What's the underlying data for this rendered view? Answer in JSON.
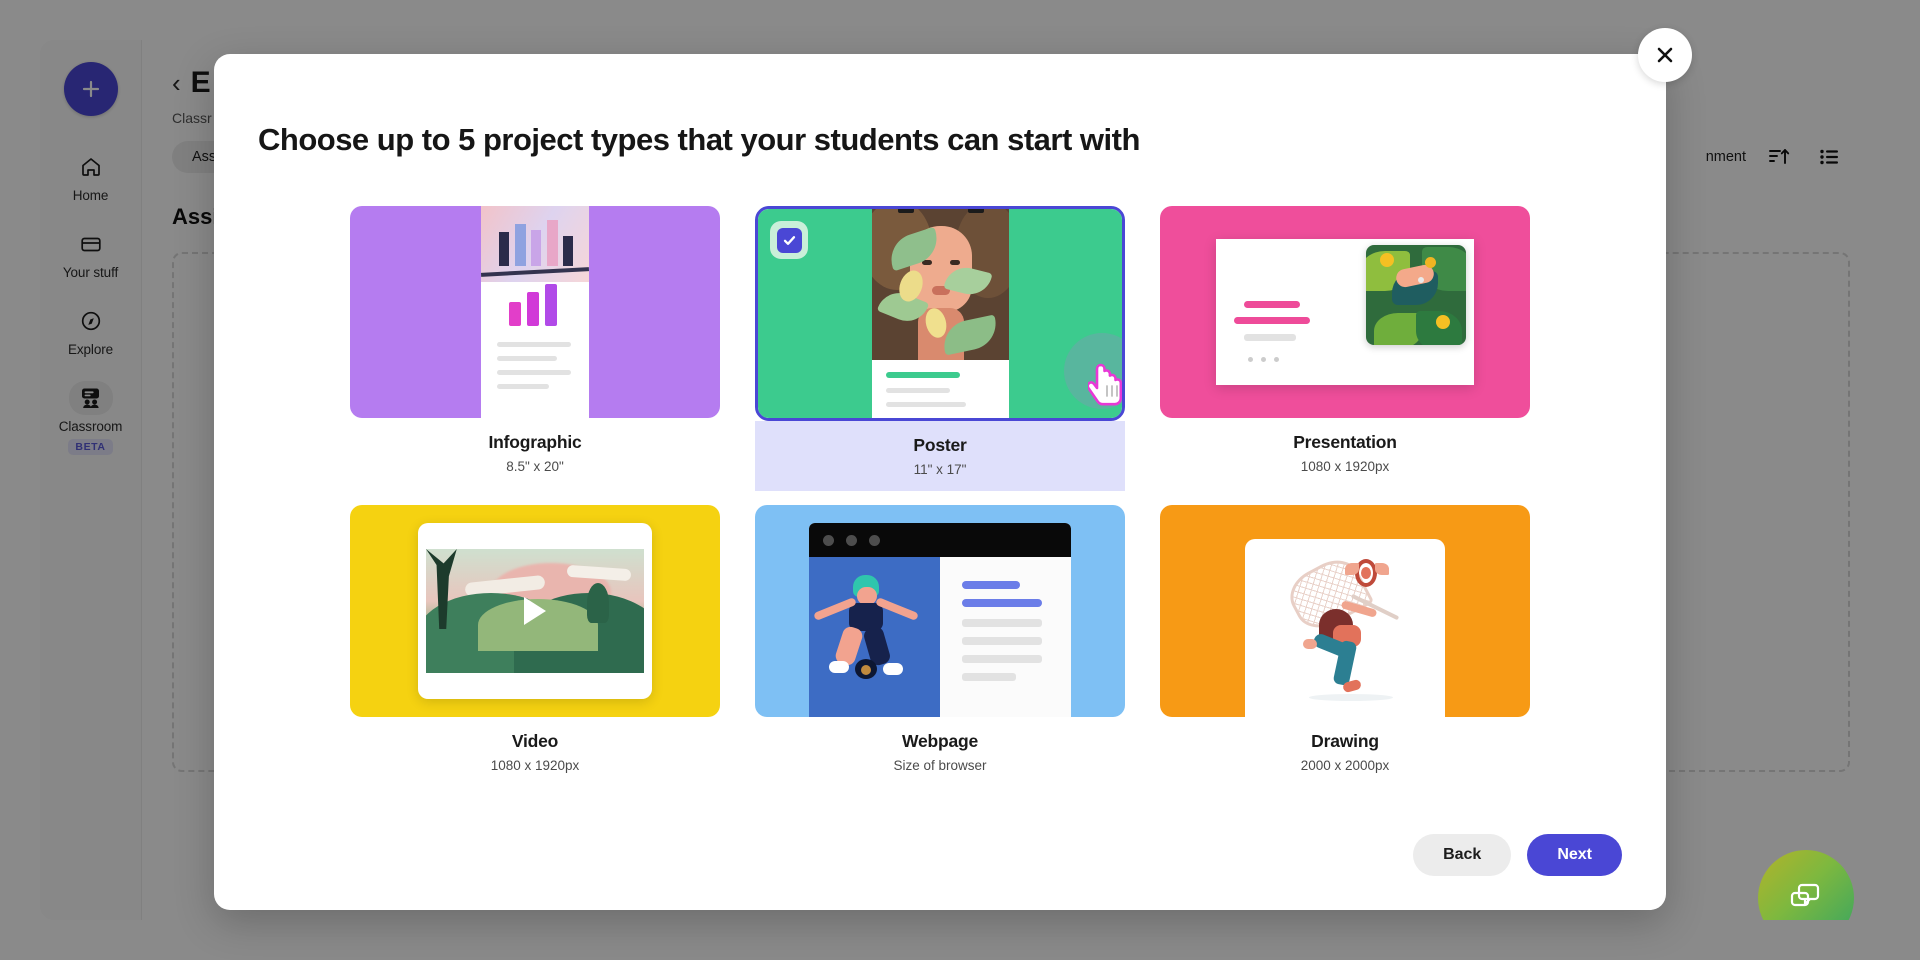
{
  "sidebar": {
    "create_button_label": "+",
    "items": [
      {
        "label": "Home",
        "icon": "home-icon",
        "active": false
      },
      {
        "label": "Your stuff",
        "icon": "folder-icon",
        "active": false
      },
      {
        "label": "Explore",
        "icon": "compass-icon",
        "active": false
      },
      {
        "label": "Classroom",
        "icon": "classroom-icon",
        "active": true,
        "badge": "BETA"
      }
    ]
  },
  "background": {
    "back_label": "‹",
    "page_title": "E",
    "breadcrumb": "Classr",
    "tab_label": "Assi",
    "section_title": "Assig",
    "new_assignment_label": "nment",
    "sort_icon": "sort-ascending-icon",
    "list_view_icon": "list-view-icon",
    "fab_icon": "chat-bubbles-icon"
  },
  "modal": {
    "close_label": "✕",
    "title": "Choose up to 5 project types that your students can start with",
    "max_selection": 5,
    "cards": [
      {
        "name": "Infographic",
        "size": "8.5\" x 20\"",
        "color": "#b57cf0",
        "selected": false,
        "art": "infographic"
      },
      {
        "name": "Poster",
        "size": "11\" x 17\"",
        "color": "#3ccb8e",
        "selected": true,
        "art": "poster"
      },
      {
        "name": "Presentation",
        "size": "1080 x 1920px",
        "color": "#ef4e9b",
        "selected": false,
        "art": "presentation"
      },
      {
        "name": "Video",
        "size": "1080 x 1920px",
        "color": "#f5d211",
        "selected": false,
        "art": "video"
      },
      {
        "name": "Webpage",
        "size": "Size of browser",
        "color": "#7ec0f4",
        "selected": false,
        "art": "webpage"
      },
      {
        "name": "Drawing",
        "size": "2000 x 2000px",
        "color": "#f79a15",
        "selected": false,
        "art": "drawing"
      }
    ],
    "buttons": {
      "back": "Back",
      "next": "Next"
    },
    "accent_color": "#4a47d5",
    "selected_footer_color": "#dfe0fb"
  }
}
